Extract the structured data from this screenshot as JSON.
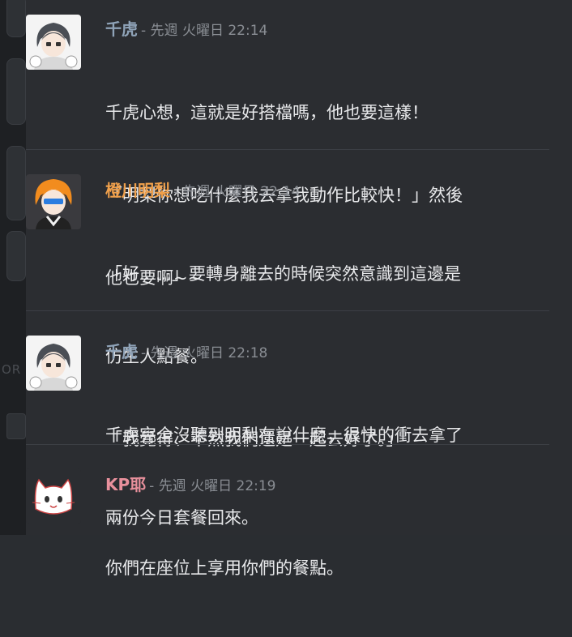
{
  "left_strip": {
    "fragment_text": "OR"
  },
  "messages": [
    {
      "author": "千虎",
      "author_color": "#8fa3b8",
      "timestamp": "- 先週 火曜日 22:14",
      "avatar_icon": "chibi-gray-hair-boy-avatar",
      "lines": [
        "千虎心想，這就是好搭檔嗎，他也要這樣！",
        "「明梨你想吃什麼我去拿我動作比較快！」然後",
        "他也要啊~~"
      ]
    },
    {
      "author": "橙川明梨",
      "author_color": "#f0a04b",
      "timestamp": "- 先週 火曜日 22:14",
      "avatar_icon": "chibi-orange-hair-boy-avatar",
      "lines": [
        "「好......」要轉身離去的時候突然意識到這邊是",
        "仿生人點餐。",
        "「我覺得、不然我們還是一起去好了。」"
      ]
    },
    {
      "author": "千虎",
      "author_color": "#8fa3b8",
      "timestamp": "- 先週 火曜日 22:18",
      "avatar_icon": "chibi-gray-hair-boy-avatar",
      "lines": [
        "千虎完全沒聽到明梨在說什麼，很快的衝去拿了",
        "兩份今日套餐回來。"
      ]
    },
    {
      "author": "KP耶",
      "author_color": "#e8909c",
      "timestamp": "- 先週 火曜日 22:19",
      "avatar_icon": "white-cat-avatar",
      "lines": [
        "你們在座位上享用你們的餐點。"
      ]
    }
  ]
}
